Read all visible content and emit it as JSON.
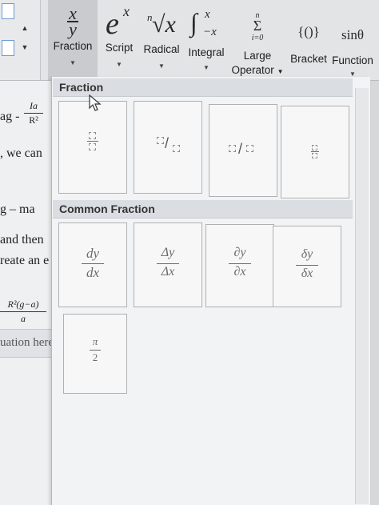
{
  "ribbon": {
    "buttons": [
      {
        "id": "fraction",
        "glyph": "x/y",
        "label": "Fraction"
      },
      {
        "id": "script",
        "glyph": "e^x",
        "label": "Script"
      },
      {
        "id": "radical",
        "glyph": "ⁿ√x",
        "label": "Radical"
      },
      {
        "id": "integral",
        "glyph": "∫x -x",
        "label": "Integral"
      },
      {
        "id": "large-operator",
        "glyph": "Σ n i=0",
        "label_line1": "Large",
        "label_line2": "Operator"
      },
      {
        "id": "bracket",
        "glyph": "{()}",
        "label": "Bracket"
      },
      {
        "id": "function",
        "glyph": "sinθ",
        "label": "Function"
      }
    ]
  },
  "document": {
    "line1": "ag -",
    "line1_frac_num": "Ia",
    "line1_frac_den": "R²",
    "line2": ", we can",
    "line3": "g – ma",
    "line4": "and then",
    "line5": "reate an e",
    "line6_num": "R²(g−a)",
    "line6_den": "a",
    "placeholder": "uation here"
  },
  "gallery": {
    "section_fraction": "Fraction",
    "section_common": "Common Fraction",
    "common": [
      {
        "num": "dy",
        "den": "dx"
      },
      {
        "num": "Δy",
        "den": "Δx"
      },
      {
        "num": "∂y",
        "den": "∂x"
      },
      {
        "num": "δy",
        "den": "δx"
      },
      {
        "num": "π",
        "den": "2"
      }
    ]
  },
  "symbols": {
    "fraction_num": "x",
    "fraction_den": "y",
    "script_base": "e",
    "script_sup": "x",
    "radical_index": "n",
    "radical_sym": "√x",
    "integral_sym": "∫",
    "integral_up": "x",
    "integral_low": "−x",
    "sum_top": "n",
    "sum_sym": "Σ",
    "sum_bottom": "i=0",
    "bracket_sym": "{()}",
    "function_sym": "sinθ"
  }
}
